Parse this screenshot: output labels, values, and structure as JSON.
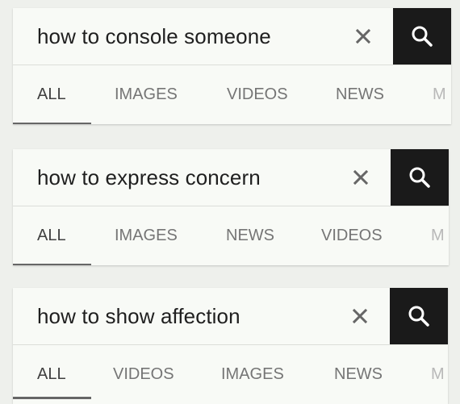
{
  "panels": [
    {
      "query": "how to console someone",
      "tabs": [
        "ALL",
        "IMAGES",
        "VIDEOS",
        "NEWS",
        "M"
      ],
      "active_tab": "ALL"
    },
    {
      "query": "how to express concern",
      "tabs": [
        "ALL",
        "IMAGES",
        "NEWS",
        "VIDEOS",
        "M"
      ],
      "active_tab": "ALL"
    },
    {
      "query": "how to show affection",
      "tabs": [
        "ALL",
        "VIDEOS",
        "IMAGES",
        "NEWS",
        "M"
      ],
      "active_tab": "ALL"
    }
  ],
  "icons": {
    "clear": "close-icon",
    "search": "search-icon"
  },
  "colors": {
    "search_button": "#1a1a1a",
    "background": "#eef0ec",
    "panel": "#f8faf6"
  }
}
